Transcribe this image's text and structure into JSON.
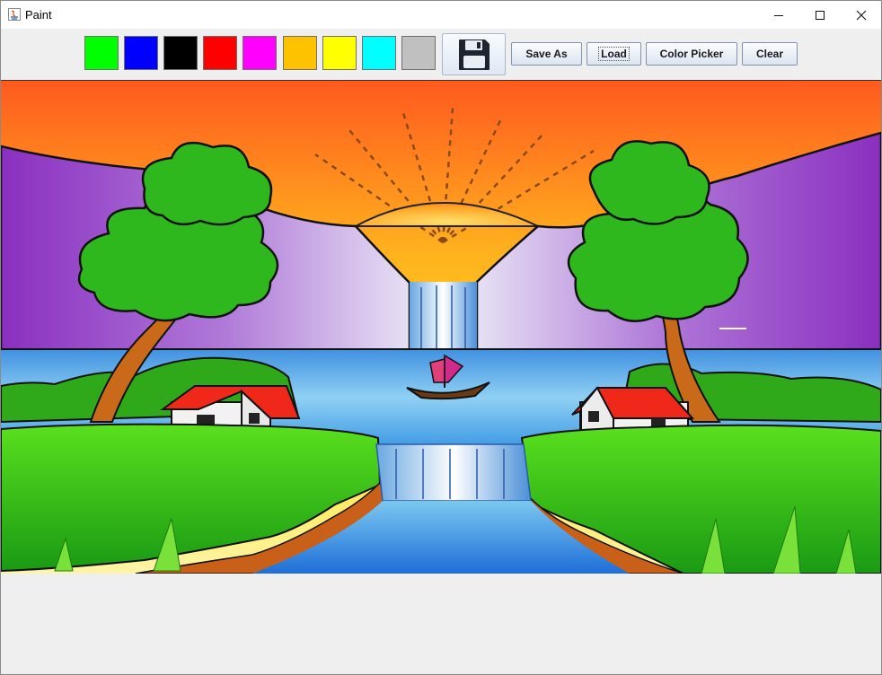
{
  "window": {
    "title": "Paint",
    "controls": {
      "minimize": "minimize-icon",
      "maximize": "maximize-icon",
      "close": "close-icon"
    }
  },
  "toolbar": {
    "colors": [
      {
        "name": "green",
        "hex": "#00ff00"
      },
      {
        "name": "blue",
        "hex": "#0000ff"
      },
      {
        "name": "black",
        "hex": "#000000"
      },
      {
        "name": "red",
        "hex": "#ff0000"
      },
      {
        "name": "magenta",
        "hex": "#ff00ff"
      },
      {
        "name": "orange",
        "hex": "#ffc200"
      },
      {
        "name": "yellow",
        "hex": "#ffff00"
      },
      {
        "name": "cyan",
        "hex": "#00ffff"
      },
      {
        "name": "gray",
        "hex": "#c0c0c0"
      }
    ],
    "save_icon": "floppy-disk-icon",
    "save_as_label": "Save As",
    "load_label": "Load",
    "color_picker_label": "Color Picker",
    "clear_label": "Clear"
  },
  "canvas": {
    "palette": {
      "sky_top": "#ff6a1a",
      "sky_mid": "#ffd21a",
      "mountain": "#9a3fc9",
      "sun": "#ffb21a",
      "water": "#4aa8e8",
      "grass": "#2fc21a",
      "roof": "#f02a1a",
      "trunk": "#c86a1a",
      "tree": "#2faa1a"
    }
  }
}
